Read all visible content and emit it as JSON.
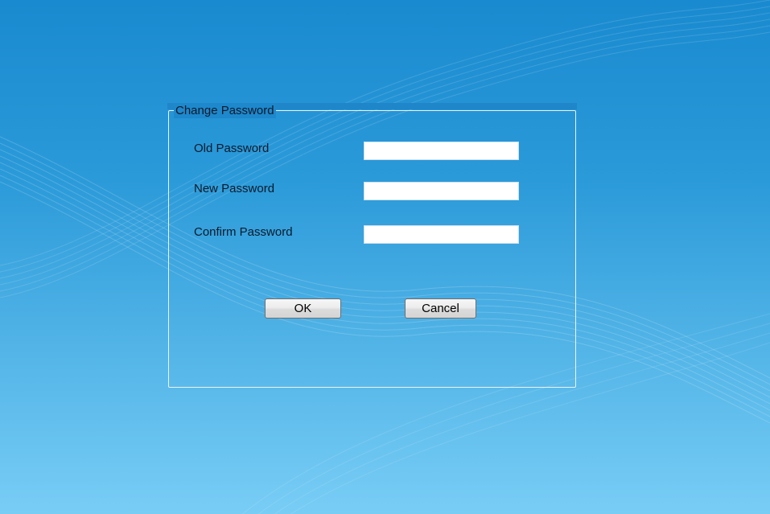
{
  "dialog": {
    "title": "Change Password"
  },
  "form": {
    "fields": [
      {
        "label": "Old Password",
        "value": "",
        "placeholder": ""
      },
      {
        "label": "New Password",
        "value": "",
        "placeholder": ""
      },
      {
        "label": "Confirm Password",
        "value": "",
        "placeholder": ""
      }
    ]
  },
  "buttons": {
    "ok_label": "OK",
    "cancel_label": "Cancel"
  },
  "colors": {
    "background_top": "#1a8ad0",
    "background_bottom": "#78cdf5",
    "dialog_border": "#e9f4fb",
    "input_background": "#ffffff"
  }
}
